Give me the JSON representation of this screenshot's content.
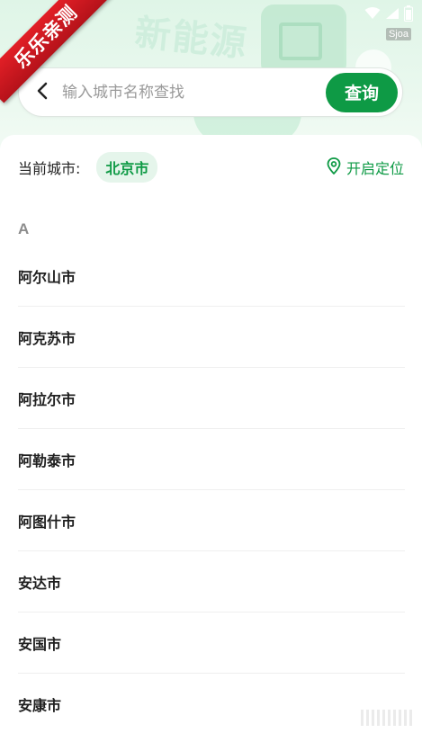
{
  "ribbon": {
    "text": "乐乐亲测"
  },
  "header": {
    "background_word": "新能源"
  },
  "status_bar": {
    "watermark": "Sjoa"
  },
  "search": {
    "placeholder": "输入城市名称查找",
    "value": "",
    "button_label": "查询"
  },
  "current": {
    "label": "当前城市:",
    "city": "北京市",
    "locate_label": "开启定位"
  },
  "section": {
    "letter": "A"
  },
  "cities": [
    "阿尔山市",
    "阿克苏市",
    "阿拉尔市",
    "阿勒泰市",
    "阿图什市",
    "安达市",
    "安国市",
    "安康市"
  ],
  "colors": {
    "accent": "#0e9a45",
    "chip_bg": "#e5f5eb",
    "ribbon": "#d9181f"
  },
  "icons": [
    "back-chevron-icon",
    "location-pin-icon",
    "wifi-icon",
    "signal-icon",
    "battery-icon"
  ]
}
